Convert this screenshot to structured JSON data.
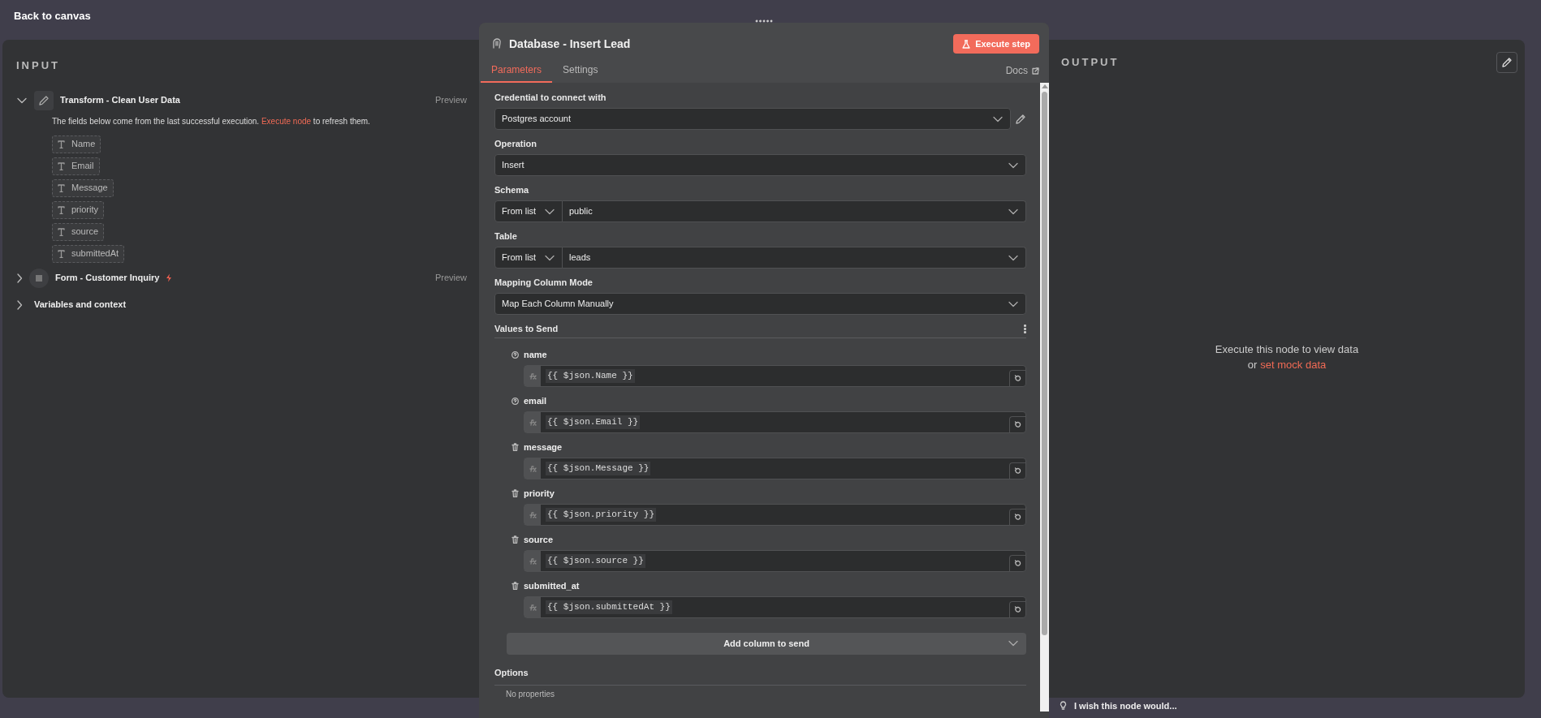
{
  "top_bar": {
    "back_label": "Back to canvas"
  },
  "input_panel": {
    "title": "INPUT",
    "nodes": [
      {
        "name": "Transform - Clean User Data",
        "expanded": true,
        "trigger": false,
        "action": "Preview",
        "note_before": "The fields below come from the last successful execution.",
        "note_link": "Execute node",
        "note_after": "to refresh them.",
        "fields": [
          "Name",
          "Email",
          "Message",
          "priority",
          "source",
          "submittedAt"
        ]
      },
      {
        "name": "Form - Customer Inquiry",
        "expanded": false,
        "trigger": true,
        "action": "Preview"
      }
    ],
    "variables": {
      "label": "Variables and context",
      "expanded": false
    }
  },
  "node_panel": {
    "title": "Database - Insert Lead",
    "execute_button": "Execute step",
    "tabs": [
      {
        "label": "Parameters",
        "selected": true
      },
      {
        "label": "Settings",
        "selected": false
      }
    ],
    "docs": "Docs",
    "parameters": [
      {
        "kind": "credential",
        "label": "Credential to connect with",
        "value": "Postgres account"
      },
      {
        "kind": "select",
        "label": "Operation",
        "value": "Insert"
      },
      {
        "kind": "mode_select",
        "label": "Schema",
        "mode": "From list",
        "value": "public"
      },
      {
        "kind": "mode_select",
        "label": "Table",
        "mode": "From list",
        "value": "leads"
      },
      {
        "kind": "select",
        "label": "Mapping Column Mode",
        "value": "Map Each Column Manually"
      }
    ],
    "values_to_send": {
      "title": "Values to Send",
      "columns": [
        {
          "name": "name",
          "removable": false,
          "expression": "{{ $json.Name }}"
        },
        {
          "name": "email",
          "removable": false,
          "expression": "{{ $json.Email }}"
        },
        {
          "name": "message",
          "removable": true,
          "expression": "{{ $json.Message }}"
        },
        {
          "name": "priority",
          "removable": true,
          "expression": "{{ $json.priority }}"
        },
        {
          "name": "source",
          "removable": true,
          "expression": "{{ $json.source }}"
        },
        {
          "name": "submitted_at",
          "removable": true,
          "expression": "{{ $json.submittedAt }}"
        }
      ]
    },
    "add_column": "Add column to send",
    "options": {
      "title": "Options",
      "empty": "No properties"
    }
  },
  "output_panel": {
    "title": "OUTPUT",
    "empty_message": "Execute this node to view data",
    "or": "or",
    "mock_link": "set mock data"
  },
  "feedback": "I wish this node would..."
}
